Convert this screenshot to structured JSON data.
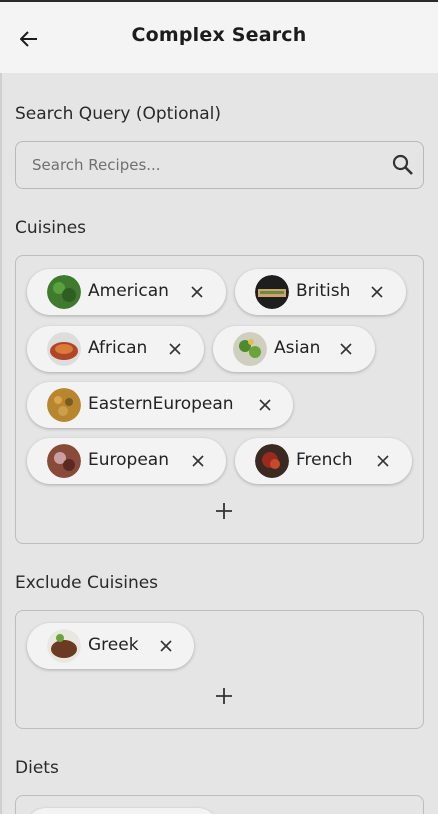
{
  "app_bar": {
    "title": "Complex Search",
    "back_icon": "arrow-left-icon"
  },
  "search": {
    "label": "Search Query (Optional)",
    "placeholder": "Search Recipes...",
    "value": "",
    "icon": "search-icon"
  },
  "cuisines": {
    "label": "Cuisines",
    "chips": [
      {
        "label": "American",
        "color": "#3f7a2e"
      },
      {
        "label": "British",
        "color": "#8a6a3a"
      },
      {
        "label": "African",
        "color": "#b0452a"
      },
      {
        "label": "Asian",
        "color": "#4f8a2e"
      },
      {
        "label": "EasternEuropean",
        "color": "#b8862e"
      },
      {
        "label": "European",
        "color": "#8a4a3a"
      },
      {
        "label": "French",
        "color": "#9a2a1e"
      }
    ],
    "add_icon": "plus-icon"
  },
  "exclude_cuisines": {
    "label": "Exclude Cuisines",
    "chips": [
      {
        "label": "Greek",
        "color": "#6a3a22"
      }
    ],
    "add_icon": "plus-icon"
  },
  "diets": {
    "label": "Diets"
  },
  "colors": {
    "background": "#e5e5e5",
    "app_bar": "#f4f4f4",
    "chip": "#f3f3f3"
  }
}
